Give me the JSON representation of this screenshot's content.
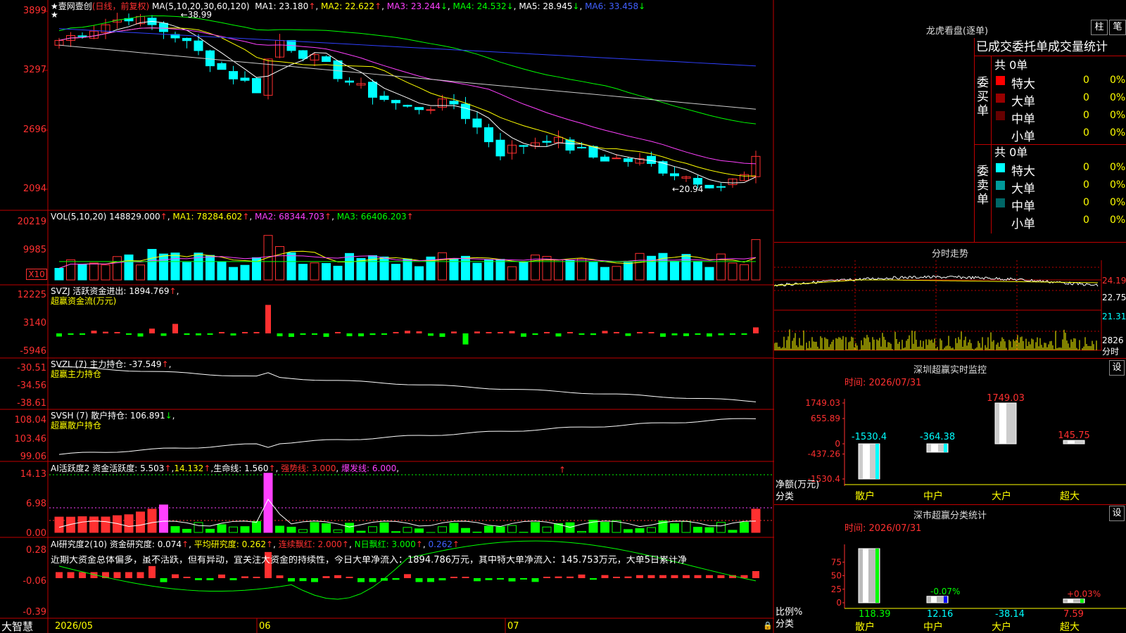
{
  "chart": {
    "stock_name": "壹网壹创",
    "period_label": "(日线，前复权)",
    "ma_label": "MA(5,10,20,30,60,120)",
    "ma": [
      {
        "name": "MA1",
        "value": "23.180",
        "arrow": "↑",
        "color": "#ffffff"
      },
      {
        "name": "MA2",
        "value": "22.622",
        "arrow": "↑",
        "color": "#ffff00"
      },
      {
        "name": "MA3",
        "value": "23.244",
        "arrow": "↓",
        "color": "#ff40ff"
      },
      {
        "name": "MA4",
        "value": "24.532",
        "arrow": "↓",
        "color": "#00ff00"
      },
      {
        "name": "MA5",
        "value": "28.945",
        "arrow": "↓",
        "color": "#cccccc"
      },
      {
        "name": "MA6",
        "value": "33.458",
        "arrow": "↓",
        "color": "#3040ff"
      }
    ],
    "price_axis": [
      "3899",
      "3297",
      "2696",
      "2094"
    ],
    "high_marker": "38.99",
    "low_marker": "←20.94",
    "vol": {
      "label": "VOL(5,10,20)",
      "value": "148829.000",
      "ma1": "78284.602",
      "ma2": "68344.703",
      "ma3": "66406.203",
      "axis": [
        "20219",
        "9985"
      ],
      "unit": "X10"
    },
    "svzj": {
      "label": "SVZJ  活跃资金进出:",
      "value": "1894.769",
      "sub": "超赢资金流(万元)",
      "axis": [
        "12225",
        "3140",
        "-5946"
      ]
    },
    "svzl": {
      "label": "SVZL (7) 主力持仓:",
      "value": "-37.549",
      "sub": "超赢主力持仓",
      "axis": [
        "-30.51",
        "-34.56",
        "-38.61"
      ]
    },
    "svsh": {
      "label": "SVSH (7) 散户持仓:",
      "value": "106.891",
      "sub": "超赢散户持仓",
      "axis": [
        "108.04",
        "103.46",
        "99.06"
      ]
    },
    "ai1": {
      "label": "AI活跃度2 资金活跃度:",
      "value": "5.503",
      "v2": "14.132",
      "life_label": "生命线:",
      "life": "1.560",
      "strong": "强势线: 3.000",
      "burst": "爆发线: 6.000",
      "axis": [
        "14.13",
        "6.98",
        "0.00"
      ]
    },
    "ai2": {
      "label": "AI研究度2(10) 资金研究度:",
      "value": "0.074",
      "avg": "平均研究度: 0.262",
      "red": "连续飘红: 2.000",
      "nred": "N日飘红: 3.000",
      "last": "0.262",
      "axis": [
        "0.28",
        "-0.06",
        "-0.39"
      ]
    },
    "comment": "近期大资金总体偏多，虽不活跃，但有异动，宜关注大资金的持续性，今日大单净流入：1894.786万元，其中特大单净流入：145.753万元，大单5日累计净",
    "dates": [
      "2026/05",
      "06",
      "07"
    ],
    "brand": "大智慧"
  },
  "dragon": {
    "title": "龙虎看盘(逐单)",
    "btn1": "柱",
    "btn2": "笔",
    "header": "已成交委托单成交量统计",
    "buy_label": "委买单",
    "sell_label": "委卖单",
    "buy_total": "共 0单",
    "sell_total": "共 0单",
    "buy_rows": [
      {
        "label": "特大",
        "count": "0",
        "pct": "0%",
        "color": "#ff0000"
      },
      {
        "label": "大单",
        "count": "0",
        "pct": "0%",
        "color": "#990000"
      },
      {
        "label": "中单",
        "count": "0",
        "pct": "0%",
        "color": "#660000"
      },
      {
        "label": "小单",
        "count": "0",
        "pct": "0%",
        "color": "#000000"
      }
    ],
    "sell_rows": [
      {
        "label": "特大",
        "count": "0",
        "pct": "0%",
        "color": "#00ffff"
      },
      {
        "label": "大单",
        "count": "0",
        "pct": "0%",
        "color": "#009999"
      },
      {
        "label": "中单",
        "count": "0",
        "pct": "0%",
        "color": "#006666"
      },
      {
        "label": "小单",
        "count": "0",
        "pct": "0%",
        "color": "#000000"
      }
    ]
  },
  "intraday": {
    "title": "分时走势",
    "axis": [
      "24.19",
      "22.75",
      "21.31",
      "2826"
    ],
    "unit": "分时"
  },
  "sz_monitor": {
    "title": "深圳超赢实时监控",
    "btn": "设",
    "time": "时间: 2026/07/31",
    "axis": [
      "1749.03",
      "655.89",
      "0",
      "-437.26",
      "-1530.4"
    ],
    "ylabel": "净额(万元)",
    "xlabel": "分类",
    "bars": [
      {
        "cat": "散户",
        "value": "-1530.4",
        "num": -1530.4
      },
      {
        "cat": "中户",
        "value": "-364.38",
        "num": -364.38
      },
      {
        "cat": "大户",
        "value": "1749.03",
        "num": 1749.03
      },
      {
        "cat": "超大",
        "value": "145.75",
        "num": 145.75
      }
    ]
  },
  "sz_class": {
    "title": "深市超赢分类统计",
    "btn": "设",
    "time": "时间: 2026/07/31",
    "axis": [
      "75",
      "50",
      "25",
      "0"
    ],
    "ylabel": "比例%",
    "xlabel": "分类",
    "bars": [
      {
        "cat": "散户",
        "top": "",
        "bottom": "118.39",
        "num": 100
      },
      {
        "cat": "中户",
        "top": "-0.07%",
        "bottom": "12.16",
        "num": 12
      },
      {
        "cat": "大户",
        "top": "",
        "bottom": "-38.14",
        "num": 0
      },
      {
        "cat": "超大",
        "top": "+0.03%",
        "bottom": "7.59",
        "num": 7
      }
    ]
  }
}
